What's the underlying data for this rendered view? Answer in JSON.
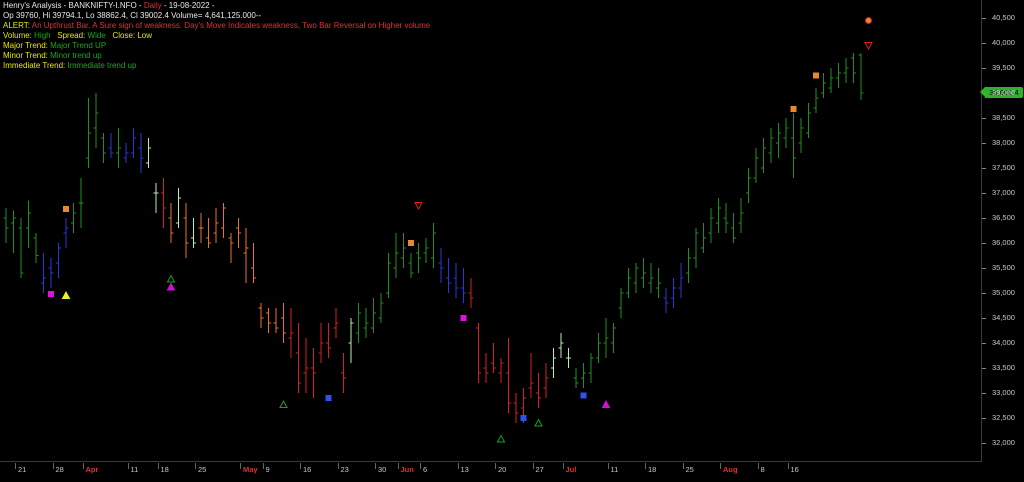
{
  "header": {
    "line1_prefix": "Henry's Analysis - BANKNIFTY-I.NFO - ",
    "line1_period": "Daily",
    "line1_date": " - 19-08-2022 -",
    "line2": "Op 39760, Hi 39794.1, Lo 38862.4, Cl 39002.4  Volume= 4,641,125.000--",
    "alert_label": "ALERT:",
    "alert_text": "An Upthrust Bar. A Sure sign of weakness. Day's Move Indicates weakness, Two Bar Reversal on Higher volume",
    "volume_label": "Volume:",
    "volume_value": "High",
    "spread_label": "Spread:",
    "spread_value": "Wide",
    "close_label": "Close:",
    "close_value": "Low",
    "major_label": "Major Trend:",
    "major_value": "Major Trend UP",
    "minor_label": "Minor Trend:",
    "minor_value": "Minor trend up",
    "immediate_label": "Immediate Trend:",
    "immediate_value": "Immediate trend up"
  },
  "price_tag": "39,002.4",
  "colors": {
    "background": "#000000",
    "up_dark_green": "#1f8f1f",
    "up_light_green": "#b8f0b0",
    "down_red": "#d42020",
    "down_orange": "#e8742c",
    "neutral_blue": "#2838d8",
    "axis_text": "#c8c8c8",
    "month_text": "#e03030"
  },
  "chart_data": {
    "type": "ohlc",
    "ylim": [
      31800,
      40800
    ],
    "y_ticks": [
      32000,
      32500,
      33000,
      33500,
      34000,
      34500,
      35000,
      35500,
      36000,
      36500,
      37000,
      37500,
      38000,
      38500,
      39000,
      39500,
      40000,
      40500
    ],
    "y_tick_labels": [
      "32,000",
      "32,500",
      "33,000",
      "33,500",
      "34,000",
      "34,500",
      "35,000",
      "35,500",
      "36,000",
      "36,500",
      "37,000",
      "37,500",
      "38,000",
      "38,500",
      "39,000",
      "39,500",
      "40,000",
      "40,500"
    ],
    "x_labels": [
      {
        "label": "21",
        "bar": 2,
        "month": false
      },
      {
        "label": "28",
        "bar": 7,
        "month": false
      },
      {
        "label": "Apr",
        "bar": 11,
        "month": true
      },
      {
        "label": "11",
        "bar": 17,
        "month": false
      },
      {
        "label": "18",
        "bar": 21,
        "month": false
      },
      {
        "label": "25",
        "bar": 26,
        "month": false
      },
      {
        "label": "May",
        "bar": 32,
        "month": true
      },
      {
        "label": "9",
        "bar": 35,
        "month": false
      },
      {
        "label": "16",
        "bar": 40,
        "month": false
      },
      {
        "label": "23",
        "bar": 45,
        "month": false
      },
      {
        "label": "30",
        "bar": 50,
        "month": false
      },
      {
        "label": "Jun",
        "bar": 53,
        "month": true
      },
      {
        "label": "6",
        "bar": 56,
        "month": false
      },
      {
        "label": "13",
        "bar": 61,
        "month": false
      },
      {
        "label": "20",
        "bar": 66,
        "month": false
      },
      {
        "label": "27",
        "bar": 71,
        "month": false
      },
      {
        "label": "Jul",
        "bar": 75,
        "month": true
      },
      {
        "label": "11",
        "bar": 81,
        "month": false
      },
      {
        "label": "18",
        "bar": 86,
        "month": false
      },
      {
        "label": "25",
        "bar": 91,
        "month": false
      },
      {
        "label": "Aug",
        "bar": 96,
        "month": true
      },
      {
        "label": "8",
        "bar": 101,
        "month": false
      },
      {
        "label": "16",
        "bar": 105,
        "month": false
      }
    ],
    "bars": [
      {
        "o": 36500,
        "h": 36700,
        "l": 36000,
        "c": 36300,
        "k": "g"
      },
      {
        "o": 36400,
        "h": 36650,
        "l": 35800,
        "c": 36500,
        "k": "g"
      },
      {
        "o": 36300,
        "h": 36500,
        "l": 35300,
        "c": 35400,
        "k": "g"
      },
      {
        "o": 36300,
        "h": 36850,
        "l": 35900,
        "c": 36600,
        "k": "g"
      },
      {
        "o": 36100,
        "h": 36200,
        "l": 35600,
        "c": 35750,
        "k": "g"
      },
      {
        "o": 35200,
        "h": 35800,
        "l": 35000,
        "c": 35300,
        "k": "b"
      },
      {
        "o": 35500,
        "h": 35700,
        "l": 35100,
        "c": 35400,
        "k": "b"
      },
      {
        "o": 35600,
        "h": 36000,
        "l": 35300,
        "c": 35900,
        "k": "b"
      },
      {
        "o": 36200,
        "h": 36500,
        "l": 35900,
        "c": 36300,
        "k": "b"
      },
      {
        "o": 36400,
        "h": 36800,
        "l": 36200,
        "c": 36600,
        "k": "g"
      },
      {
        "o": 36800,
        "h": 37300,
        "l": 36300,
        "c": 36800,
        "k": "g"
      },
      {
        "o": 37700,
        "h": 38900,
        "l": 37500,
        "c": 38200,
        "k": "g"
      },
      {
        "o": 38300,
        "h": 39000,
        "l": 37900,
        "c": 38600,
        "k": "g"
      },
      {
        "o": 38100,
        "h": 38200,
        "l": 37600,
        "c": 37800,
        "k": "g"
      },
      {
        "o": 37900,
        "h": 38200,
        "l": 37700,
        "c": 37800,
        "k": "b"
      },
      {
        "o": 37800,
        "h": 38300,
        "l": 37500,
        "c": 37900,
        "k": "g"
      },
      {
        "o": 37700,
        "h": 38000,
        "l": 37600,
        "c": 37800,
        "k": "b"
      },
      {
        "o": 37800,
        "h": 38300,
        "l": 37700,
        "c": 38100,
        "k": "b"
      },
      {
        "o": 37900,
        "h": 38200,
        "l": 37400,
        "c": 37700,
        "k": "b"
      },
      {
        "o": 37600,
        "h": 38100,
        "l": 37500,
        "c": 37900,
        "k": "lg"
      },
      {
        "o": 37000,
        "h": 37200,
        "l": 36600,
        "c": 37000,
        "k": "lg"
      },
      {
        "o": 37000,
        "h": 37300,
        "l": 36300,
        "c": 36700,
        "k": "r"
      },
      {
        "o": 36500,
        "h": 36800,
        "l": 36000,
        "c": 36200,
        "k": "o"
      },
      {
        "o": 36400,
        "h": 37100,
        "l": 36300,
        "c": 36900,
        "k": "lg"
      },
      {
        "o": 36500,
        "h": 36800,
        "l": 35700,
        "c": 36000,
        "k": "o"
      },
      {
        "o": 36100,
        "h": 36500,
        "l": 35900,
        "c": 36000,
        "k": "lg"
      },
      {
        "o": 36300,
        "h": 36600,
        "l": 36000,
        "c": 36300,
        "k": "o"
      },
      {
        "o": 36100,
        "h": 36500,
        "l": 35900,
        "c": 36000,
        "k": "o"
      },
      {
        "o": 36200,
        "h": 36700,
        "l": 36000,
        "c": 36400,
        "k": "o"
      },
      {
        "o": 36300,
        "h": 36800,
        "l": 36100,
        "c": 36700,
        "k": "o"
      },
      {
        "o": 36100,
        "h": 36200,
        "l": 35600,
        "c": 36000,
        "k": "o"
      },
      {
        "o": 36300,
        "h": 36500,
        "l": 35900,
        "c": 36200,
        "k": "o"
      },
      {
        "o": 35800,
        "h": 36300,
        "l": 35200,
        "c": 35900,
        "k": "o"
      },
      {
        "o": 35500,
        "h": 36000,
        "l": 35200,
        "c": 35300,
        "k": "o"
      },
      {
        "o": 34700,
        "h": 34800,
        "l": 34300,
        "c": 34500,
        "k": "o"
      },
      {
        "o": 34600,
        "h": 34700,
        "l": 34200,
        "c": 34400,
        "k": "o"
      },
      {
        "o": 34400,
        "h": 34700,
        "l": 34200,
        "c": 34300,
        "k": "o"
      },
      {
        "o": 34500,
        "h": 34800,
        "l": 34000,
        "c": 34200,
        "k": "o"
      },
      {
        "o": 34100,
        "h": 34700,
        "l": 33700,
        "c": 34200,
        "k": "r"
      },
      {
        "o": 33800,
        "h": 34400,
        "l": 33000,
        "c": 33200,
        "k": "r"
      },
      {
        "o": 33400,
        "h": 34100,
        "l": 33000,
        "c": 33500,
        "k": "r"
      },
      {
        "o": 33500,
        "h": 33900,
        "l": 32900,
        "c": 33400,
        "k": "r"
      },
      {
        "o": 33800,
        "h": 34400,
        "l": 33600,
        "c": 34000,
        "k": "r"
      },
      {
        "o": 34000,
        "h": 34400,
        "l": 33700,
        "c": 33900,
        "k": "r"
      },
      {
        "o": 34300,
        "h": 34700,
        "l": 34100,
        "c": 34400,
        "k": "r"
      },
      {
        "o": 33400,
        "h": 33800,
        "l": 33000,
        "c": 33300,
        "k": "r"
      },
      {
        "o": 34000,
        "h": 34500,
        "l": 33600,
        "c": 34400,
        "k": "lg"
      },
      {
        "o": 34200,
        "h": 34800,
        "l": 34000,
        "c": 34600,
        "k": "g"
      },
      {
        "o": 34300,
        "h": 34700,
        "l": 34100,
        "c": 34400,
        "k": "g"
      },
      {
        "o": 34300,
        "h": 34900,
        "l": 34200,
        "c": 34600,
        "k": "g"
      },
      {
        "o": 34500,
        "h": 35000,
        "l": 34400,
        "c": 34800,
        "k": "g"
      },
      {
        "o": 35000,
        "h": 35800,
        "l": 34900,
        "c": 35600,
        "k": "g"
      },
      {
        "o": 35500,
        "h": 36200,
        "l": 35300,
        "c": 35800,
        "k": "g"
      },
      {
        "o": 35700,
        "h": 36200,
        "l": 35500,
        "c": 35900,
        "k": "g"
      },
      {
        "o": 35600,
        "h": 35800,
        "l": 35300,
        "c": 35400,
        "k": "g"
      },
      {
        "o": 35800,
        "h": 36000,
        "l": 35400,
        "c": 35700,
        "k": "g"
      },
      {
        "o": 35800,
        "h": 36100,
        "l": 35600,
        "c": 35900,
        "k": "g"
      },
      {
        "o": 35700,
        "h": 36400,
        "l": 35500,
        "c": 36200,
        "k": "g"
      },
      {
        "o": 35600,
        "h": 35900,
        "l": 35200,
        "c": 35500,
        "k": "b"
      },
      {
        "o": 35300,
        "h": 35700,
        "l": 35000,
        "c": 35200,
        "k": "b"
      },
      {
        "o": 35300,
        "h": 35600,
        "l": 34900,
        "c": 35100,
        "k": "b"
      },
      {
        "o": 35100,
        "h": 35500,
        "l": 34800,
        "c": 35000,
        "k": "b"
      },
      {
        "o": 35000,
        "h": 35300,
        "l": 34700,
        "c": 34900,
        "k": "r"
      },
      {
        "o": 34300,
        "h": 34400,
        "l": 33200,
        "c": 33400,
        "k": "r"
      },
      {
        "o": 33500,
        "h": 33800,
        "l": 33200,
        "c": 33400,
        "k": "r"
      },
      {
        "o": 33600,
        "h": 34000,
        "l": 33400,
        "c": 33500,
        "k": "r"
      },
      {
        "o": 33400,
        "h": 33700,
        "l": 33200,
        "c": 33600,
        "k": "r"
      },
      {
        "o": 33400,
        "h": 34100,
        "l": 32600,
        "c": 32800,
        "k": "r"
      },
      {
        "o": 32800,
        "h": 33000,
        "l": 32400,
        "c": 32600,
        "k": "r"
      },
      {
        "o": 32700,
        "h": 33100,
        "l": 32400,
        "c": 32900,
        "k": "r"
      },
      {
        "o": 33100,
        "h": 33800,
        "l": 32900,
        "c": 33200,
        "k": "r"
      },
      {
        "o": 33000,
        "h": 33400,
        "l": 32700,
        "c": 32900,
        "k": "r"
      },
      {
        "o": 33100,
        "h": 33600,
        "l": 32900,
        "c": 33300,
        "k": "r"
      },
      {
        "o": 33500,
        "h": 33900,
        "l": 33300,
        "c": 33700,
        "k": "lg"
      },
      {
        "o": 33900,
        "h": 34200,
        "l": 33700,
        "c": 34000,
        "k": "lg"
      },
      {
        "o": 33700,
        "h": 33900,
        "l": 33500,
        "c": 33700,
        "k": "lg"
      },
      {
        "o": 33300,
        "h": 33500,
        "l": 33100,
        "c": 33200,
        "k": "g"
      },
      {
        "o": 33300,
        "h": 33600,
        "l": 33100,
        "c": 33400,
        "k": "g"
      },
      {
        "o": 33400,
        "h": 33800,
        "l": 33200,
        "c": 33700,
        "k": "g"
      },
      {
        "o": 33700,
        "h": 34200,
        "l": 33600,
        "c": 34000,
        "k": "g"
      },
      {
        "o": 34000,
        "h": 34500,
        "l": 33700,
        "c": 34100,
        "k": "g"
      },
      {
        "o": 34000,
        "h": 34400,
        "l": 33800,
        "c": 34300,
        "k": "g"
      },
      {
        "o": 34700,
        "h": 35100,
        "l": 34500,
        "c": 35000,
        "k": "g"
      },
      {
        "o": 35000,
        "h": 35500,
        "l": 34900,
        "c": 35300,
        "k": "g"
      },
      {
        "o": 35200,
        "h": 35600,
        "l": 35000,
        "c": 35500,
        "k": "g"
      },
      {
        "o": 35300,
        "h": 35700,
        "l": 35100,
        "c": 35400,
        "k": "g"
      },
      {
        "o": 35200,
        "h": 35600,
        "l": 35000,
        "c": 35300,
        "k": "g"
      },
      {
        "o": 35100,
        "h": 35500,
        "l": 34900,
        "c": 35200,
        "k": "g"
      },
      {
        "o": 34900,
        "h": 35100,
        "l": 34600,
        "c": 34800,
        "k": "b"
      },
      {
        "o": 34900,
        "h": 35300,
        "l": 34700,
        "c": 35100,
        "k": "b"
      },
      {
        "o": 35100,
        "h": 35600,
        "l": 34900,
        "c": 35300,
        "k": "b"
      },
      {
        "o": 35400,
        "h": 35900,
        "l": 35200,
        "c": 35700,
        "k": "g"
      },
      {
        "o": 35700,
        "h": 36300,
        "l": 35500,
        "c": 36200,
        "k": "g"
      },
      {
        "o": 35900,
        "h": 36400,
        "l": 35800,
        "c": 36100,
        "k": "g"
      },
      {
        "o": 36200,
        "h": 36700,
        "l": 36000,
        "c": 36500,
        "k": "g"
      },
      {
        "o": 36400,
        "h": 36900,
        "l": 36200,
        "c": 36700,
        "k": "g"
      },
      {
        "o": 36500,
        "h": 36800,
        "l": 36200,
        "c": 36400,
        "k": "g"
      },
      {
        "o": 36300,
        "h": 36600,
        "l": 36000,
        "c": 36100,
        "k": "g"
      },
      {
        "o": 36400,
        "h": 36900,
        "l": 36200,
        "c": 36600,
        "k": "g"
      },
      {
        "o": 37000,
        "h": 37500,
        "l": 36800,
        "c": 37300,
        "k": "g"
      },
      {
        "o": 37300,
        "h": 37900,
        "l": 37200,
        "c": 37700,
        "k": "g"
      },
      {
        "o": 37500,
        "h": 38100,
        "l": 37400,
        "c": 37900,
        "k": "g"
      },
      {
        "o": 37800,
        "h": 38300,
        "l": 37600,
        "c": 38100,
        "k": "g"
      },
      {
        "o": 38000,
        "h": 38400,
        "l": 37700,
        "c": 38200,
        "k": "g"
      },
      {
        "o": 38100,
        "h": 38500,
        "l": 37900,
        "c": 38300,
        "k": "g"
      },
      {
        "o": 38100,
        "h": 38600,
        "l": 37300,
        "c": 37700,
        "k": "g"
      },
      {
        "o": 38000,
        "h": 38500,
        "l": 37800,
        "c": 38300,
        "k": "g"
      },
      {
        "o": 38200,
        "h": 38800,
        "l": 38100,
        "c": 38600,
        "k": "g"
      },
      {
        "o": 38700,
        "h": 39100,
        "l": 38600,
        "c": 38900,
        "k": "g"
      },
      {
        "o": 39000,
        "h": 39400,
        "l": 38900,
        "c": 39200,
        "k": "g"
      },
      {
        "o": 39100,
        "h": 39500,
        "l": 39000,
        "c": 39300,
        "k": "g"
      },
      {
        "o": 39300,
        "h": 39600,
        "l": 39100,
        "c": 39400,
        "k": "g"
      },
      {
        "o": 39400,
        "h": 39700,
        "l": 39200,
        "c": 39500,
        "k": "g"
      },
      {
        "o": 39700,
        "h": 39800,
        "l": 39200,
        "c": 39400,
        "k": "g"
      },
      {
        "o": 39760,
        "h": 39794,
        "l": 38862,
        "c": 39002,
        "k": "g"
      }
    ],
    "signals": [
      {
        "bar": 8,
        "type": "square",
        "color": "#e88a2c",
        "price": 36680
      },
      {
        "bar": 6,
        "type": "square",
        "color": "#e010e0",
        "price": 34980
      },
      {
        "bar": 8,
        "type": "triangle-up",
        "color": "#f0f020",
        "price": 34950
      },
      {
        "bar": 22,
        "type": "triangle-up",
        "color": "#1f9f1f",
        "price": 35280
      },
      {
        "bar": 22,
        "type": "triangle-up",
        "color": "#d010d0",
        "price": 35120
      },
      {
        "bar": 37,
        "type": "triangle-up",
        "color": "#1f9f1f",
        "price": 32770
      },
      {
        "bar": 43,
        "type": "square",
        "color": "#3050f0",
        "price": 32900
      },
      {
        "bar": 55,
        "type": "triangle-down",
        "color": "#e02020",
        "price": 36750
      },
      {
        "bar": 54,
        "type": "square",
        "color": "#e88a2c",
        "price": 36000
      },
      {
        "bar": 61,
        "type": "square",
        "color": "#e010e0",
        "price": 34500
      },
      {
        "bar": 66,
        "type": "triangle-up",
        "color": "#1f9f1f",
        "price": 32080
      },
      {
        "bar": 69,
        "type": "square",
        "color": "#3050f0",
        "price": 32500
      },
      {
        "bar": 71,
        "type": "triangle-up",
        "color": "#1f9f1f",
        "price": 32400
      },
      {
        "bar": 77,
        "type": "square",
        "color": "#3050f0",
        "price": 32950
      },
      {
        "bar": 80,
        "type": "triangle-up",
        "color": "#d010d0",
        "price": 32770
      },
      {
        "bar": 105,
        "type": "square",
        "color": "#e88a2c",
        "price": 38680
      },
      {
        "bar": 108,
        "type": "square",
        "color": "#e88a2c",
        "price": 39350
      },
      {
        "bar": 115,
        "type": "triangle-down",
        "color": "#e02020",
        "price": 39950
      },
      {
        "bar": 115,
        "type": "circle",
        "color": "#e88a2c",
        "price": 40450
      }
    ]
  }
}
